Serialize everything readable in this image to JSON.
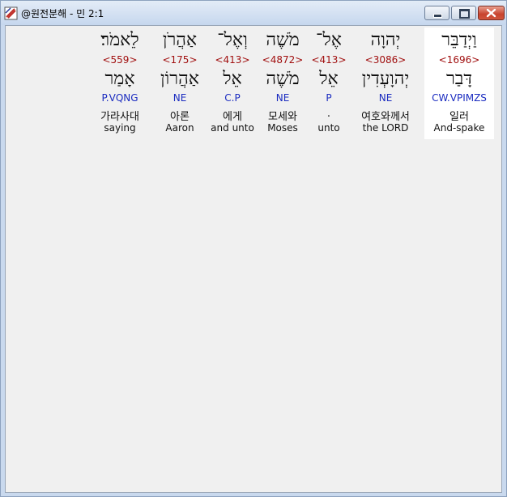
{
  "window": {
    "title": "@원전분해 - 민 2:1",
    "controls": {
      "minimize_icon": "minimize-icon",
      "maximize_icon": "maximize-icon",
      "close_icon": "close-icon"
    }
  },
  "words": [
    {
      "hebrew": "וַיְדַבֵּר",
      "strong": "<1696>",
      "root": "דָּבַר",
      "morph": "CW.VPIMZS",
      "korean": "일러",
      "english": "And-spake"
    },
    {
      "hebrew": "יְהוָה",
      "strong": "<3086>",
      "root": "יְהוָעְדִין",
      "morph": "NE",
      "korean": "여호와께서",
      "english": "the LORD"
    },
    {
      "hebrew": "אֶל־",
      "strong": "<413>",
      "root": "אֵל",
      "morph": "P",
      "korean": ".",
      "english": "unto"
    },
    {
      "hebrew": "מֹשֶׁה",
      "strong": "<4872>",
      "root": "מֹשֶׁה",
      "morph": "NE",
      "korean": "모세와",
      "english": "Moses"
    },
    {
      "hebrew": "וְאֶל־",
      "strong": "<413>",
      "root": "אֵל",
      "morph": "C.P",
      "korean": "에게",
      "english": "and unto"
    },
    {
      "hebrew": "אַהֲרֹן",
      "strong": "<175>",
      "root": "אַהֲרוֹן",
      "morph": "NE",
      "korean": "아론",
      "english": "Aaron"
    },
    {
      "hebrew": "לֵאמֹר׃",
      "strong": "<559>",
      "root": "אָמַר",
      "morph": "P.VQNG",
      "korean": "가라사대",
      "english": "saying"
    }
  ],
  "colors": {
    "strong": "#a11010",
    "morph": "#1a2bc0",
    "text": "#111111",
    "selected_bg": "#ffffff",
    "background": "#f0f0f0"
  }
}
